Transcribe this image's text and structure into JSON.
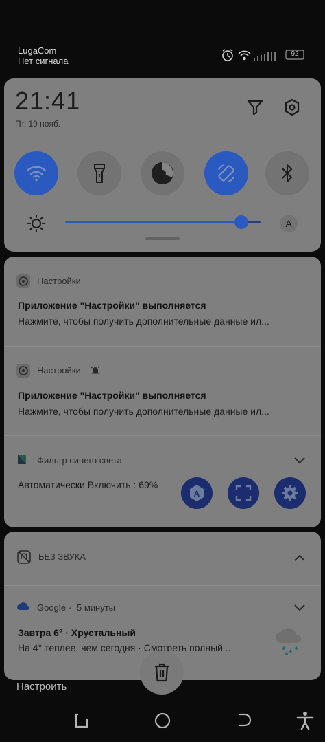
{
  "status_bar": {
    "carrier": "LugaCom",
    "signal": "Нет сигнала",
    "battery": "92"
  },
  "quick_settings": {
    "time": "21:41",
    "date": "Пт, 19 нояб.",
    "tiles": [
      {
        "name": "wifi",
        "active": true
      },
      {
        "name": "flashlight",
        "active": false
      },
      {
        "name": "data-saver",
        "active": false
      },
      {
        "name": "auto-rotate",
        "active": true
      },
      {
        "name": "bluetooth",
        "active": false
      }
    ],
    "brightness": 0.9,
    "auto_brightness_label": "A"
  },
  "notifications": [
    {
      "app": "Настройки",
      "title": "Приложение \"Настройки\" выполняется",
      "body": "Нажмите, чтобы получить дополнительные данные ил..."
    },
    {
      "app": "Настройки",
      "title": "Приложение \"Настройки\" выполняется",
      "body": "Нажмите, чтобы получить дополнительные данные ил..."
    }
  ],
  "blue_filter": {
    "app": "Фильтр синего света",
    "status": "Автоматически Включить : 69%"
  },
  "silent_section": {
    "label": "БЕЗ ЗВУКА"
  },
  "google": {
    "app": "Google",
    "time": "5 минуты",
    "title": "Завтра 6° · Хрустальный",
    "body": "На 4° теплее, чем сегодня · Смотреть полный ..."
  },
  "footer": {
    "settings_label": "Настроить"
  },
  "colors": {
    "accent": "#2a5ac0",
    "card": "#7f7f7f",
    "background": "#0a0b0a"
  }
}
